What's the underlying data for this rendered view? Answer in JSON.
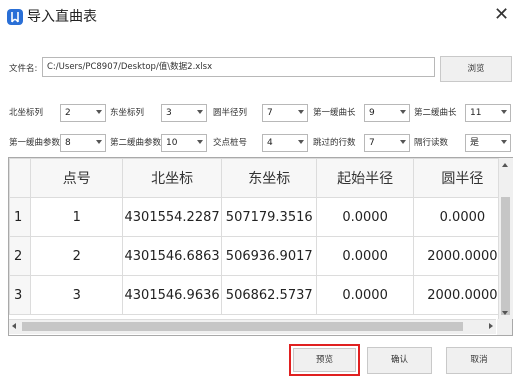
{
  "window": {
    "title": "导入直曲表"
  },
  "file": {
    "label": "文件名:",
    "path": "C:/Users/PC8907/Desktop/值\\数据2.xlsx",
    "browse_label": "浏览"
  },
  "params": [
    {
      "label": "北坐标列",
      "value": "2"
    },
    {
      "label": "东坐标列",
      "value": "3"
    },
    {
      "label": "圆半径列",
      "value": "7"
    },
    {
      "label": "第一缓曲长",
      "value": "9"
    },
    {
      "label": "第二缓曲长",
      "value": "11"
    },
    {
      "label": "第一缓曲参数",
      "value": "8"
    },
    {
      "label": "第二缓曲参数",
      "value": "10"
    },
    {
      "label": "交点桩号",
      "value": "4"
    },
    {
      "label": "跳过的行数",
      "value": "7"
    },
    {
      "label": "隔行读数",
      "value": "是"
    }
  ],
  "table": {
    "columns": [
      "点号",
      "北坐标",
      "东坐标",
      "起始半径",
      "圆半径"
    ],
    "rows": [
      {
        "index": "1",
        "cells": [
          "1",
          "4301554.2287",
          "507179.3516",
          "0.0000",
          "0.0000"
        ]
      },
      {
        "index": "2",
        "cells": [
          "2",
          "4301546.6863",
          "506936.9017",
          "0.0000",
          "2000.0000"
        ]
      },
      {
        "index": "3",
        "cells": [
          "3",
          "4301546.9636",
          "506862.5737",
          "0.0000",
          "2000.0000"
        ]
      }
    ]
  },
  "buttons": {
    "preview": "预览",
    "ok": "确认",
    "cancel": "取消"
  },
  "colors": {
    "highlight": "#e02020",
    "logo": "#2a6fd6"
  }
}
